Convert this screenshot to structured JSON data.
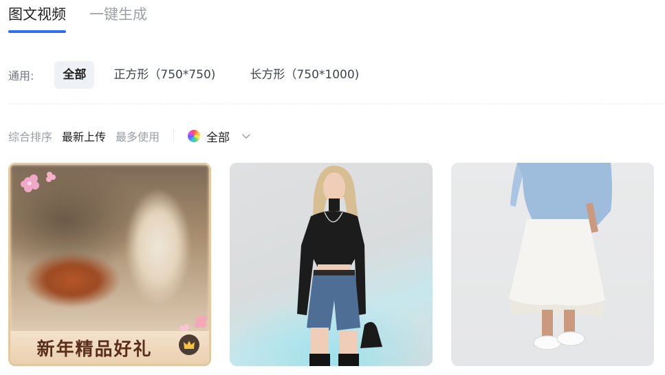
{
  "tabs": [
    {
      "label": "图文视频",
      "active": true
    },
    {
      "label": "一键生成",
      "active": false
    }
  ],
  "size_filter": {
    "label": "通用:",
    "options": [
      {
        "label": "全部",
        "active": true
      },
      {
        "label": "正方形（750*750)",
        "active": false
      },
      {
        "label": "长方形（750*1000)",
        "active": false
      }
    ]
  },
  "sort": {
    "options": [
      {
        "label": "综合排序",
        "active": false
      },
      {
        "label": "最新上传",
        "active": true
      },
      {
        "label": "最多使用",
        "active": false
      }
    ]
  },
  "color_filter": {
    "label": "全部",
    "icon": "color-wheel-icon"
  },
  "cards": [
    {
      "banner_text": "新年精品好礼",
      "badge_icon": "crown-icon"
    },
    {
      "banner_text": ""
    },
    {
      "banner_text": ""
    }
  ],
  "colors": {
    "accent": "#2d6ff0",
    "text_primary": "#1f1f1f",
    "text_secondary": "#9aa0a6",
    "chip_active_bg": "#eef1f6",
    "card1_banner_text": "#5a2e1a"
  }
}
